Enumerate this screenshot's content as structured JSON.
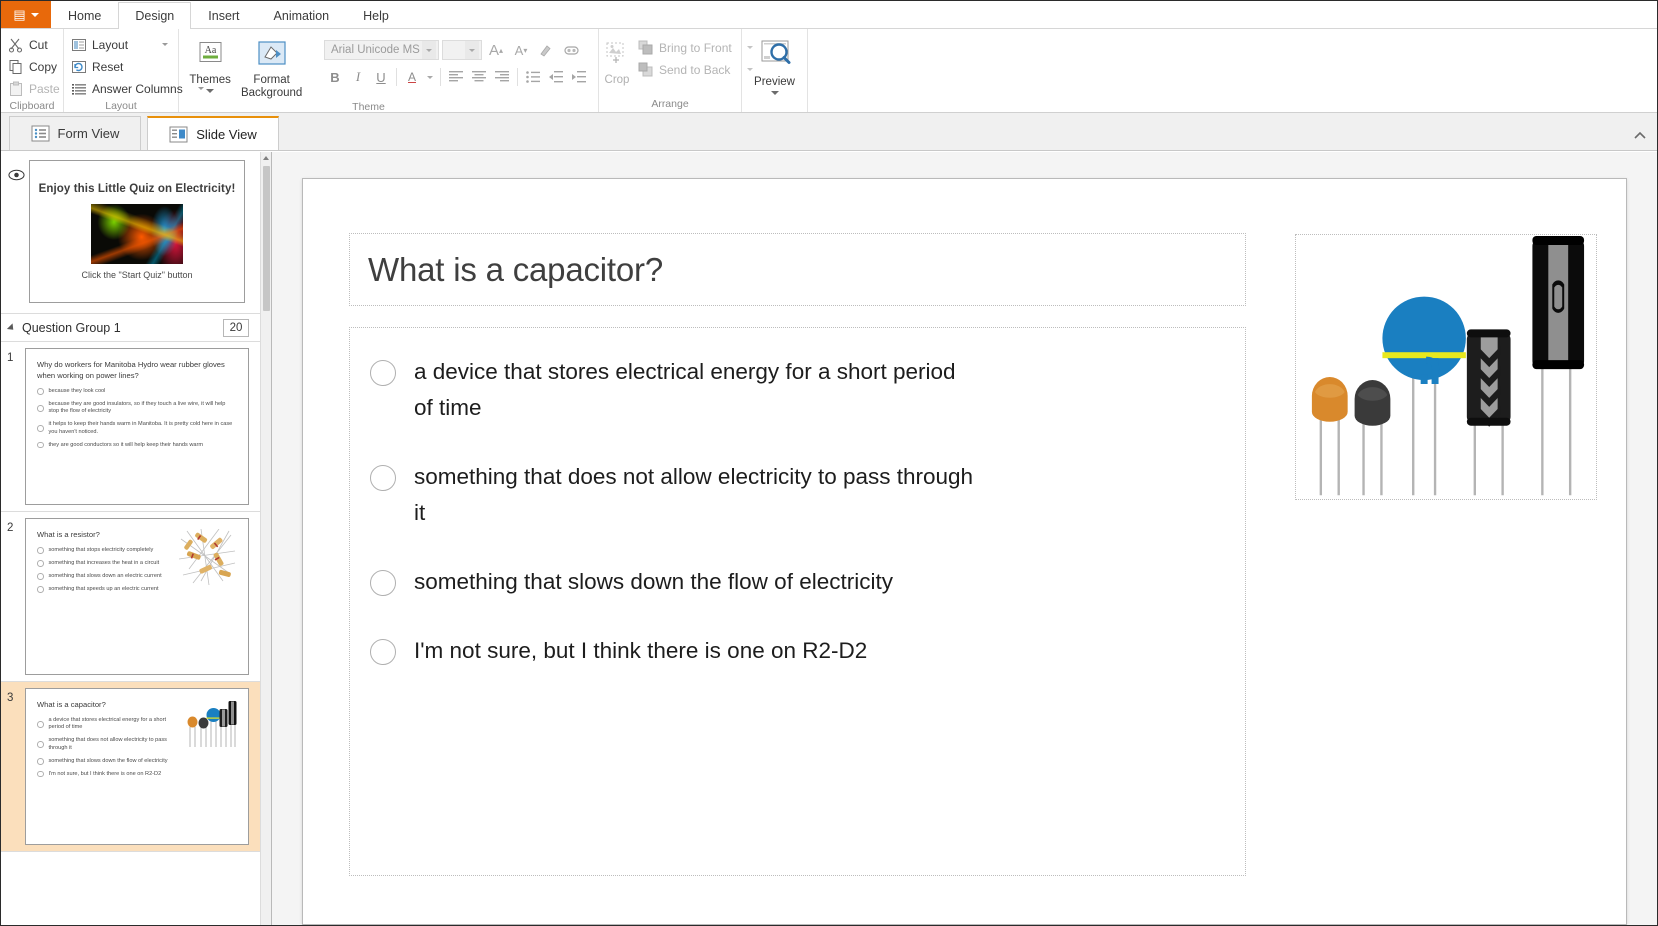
{
  "app": {
    "menu_button_icon": "menu-icon"
  },
  "ribbon": {
    "tabs": [
      {
        "label": "Home",
        "active": false
      },
      {
        "label": "Design",
        "active": true
      },
      {
        "label": "Insert",
        "active": false
      },
      {
        "label": "Animation",
        "active": false
      },
      {
        "label": "Help",
        "active": false
      }
    ],
    "groups": {
      "clipboard": {
        "label": "Clipboard",
        "cut": "Cut",
        "copy": "Copy",
        "paste": "Paste"
      },
      "layout": {
        "label": "Layout",
        "layout": "Layout",
        "reset": "Reset",
        "answer_columns": "Answer Columns"
      },
      "theme": {
        "label": "Theme",
        "themes": "Themes",
        "format_background": "Format Background",
        "font_name": "Arial Unicode MS",
        "font_size": "",
        "grow_font": "A",
        "shrink_font": "A",
        "bold": "B",
        "italic": "I",
        "underline": "U",
        "font_color": "A"
      },
      "arrange": {
        "label": "Arrange",
        "crop": "Crop",
        "bring_to_front": "Bring to Front",
        "send_to_back": "Send to Back"
      },
      "preview": {
        "label": "Preview"
      }
    }
  },
  "view_tabs": [
    {
      "label": "Form View",
      "icon": "list-view-icon",
      "active": false
    },
    {
      "label": "Slide View",
      "icon": "slide-view-icon",
      "active": true
    }
  ],
  "sidebar": {
    "intro_slide": {
      "title": "Enjoy this Little Quiz on Electricity!",
      "subtitle": "Click the \"Start Quiz\" button",
      "image_alt": "electricity-lightning-image"
    },
    "group": {
      "name": "Question Group 1",
      "count": "20"
    },
    "slides": [
      {
        "number": "1",
        "selected": false,
        "title": "Why do workers for Manitoba Hydro wear rubber gloves when working on power lines?",
        "options": [
          "because they look cool",
          "because they are good insulators, so if they touch a live wire, it will help stop the flow of electricity",
          "it helps to keep their hands warm in Manitoba. It is pretty cold here in case you haven't noticed.",
          "they are good conductors so it will help keep their hands warm"
        ],
        "image": "none"
      },
      {
        "number": "2",
        "selected": false,
        "title": "What is a resistor?",
        "options": [
          "something that stops electricity completely",
          "something that increases the heat in a circuit",
          "something that slows down an electric current",
          "something that speeds up an electric current"
        ],
        "image": "resistors-photo"
      },
      {
        "number": "3",
        "selected": true,
        "title": "What is a capacitor?",
        "options": [
          "a device that stores electrical energy for a short period of time",
          "something that does not allow electricity to pass through it",
          "something that slows down the flow of electricity",
          "I'm not sure, but I think there is one on R2-D2"
        ],
        "image": "capacitors-illustration"
      }
    ]
  },
  "slide": {
    "title": "What is a capacitor?",
    "answers": [
      "a device that stores electrical energy for a short period of time",
      "something that does not allow electricity to pass through it",
      "something that slows down the flow of electricity",
      "I'm not sure, but I think there is one on R2-D2"
    ],
    "image_alt": "capacitors-illustration"
  },
  "colors": {
    "accent_orange": "#e8690b",
    "tab_highlight": "#e8900b",
    "selected_row": "#fbdfbc",
    "capacitor_blue": "#1a7fc1",
    "capacitor_yellow": "#e8e81e",
    "capacitor_orange": "#d9892c",
    "capacitor_dark": "#3a3a3a"
  }
}
